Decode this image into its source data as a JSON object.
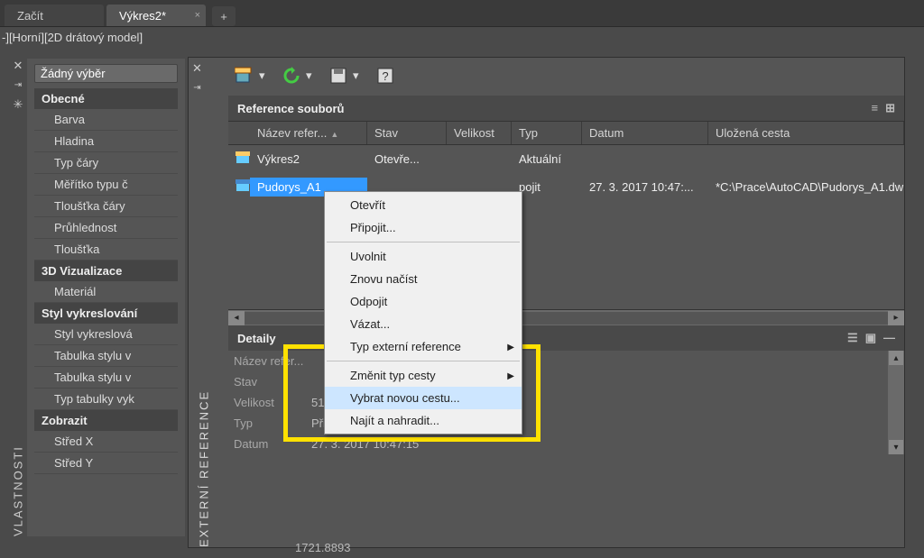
{
  "tabs": {
    "items": [
      "Začít",
      "Výkres2*"
    ],
    "active_index": 1
  },
  "viewport_label": "-][Horní][2D drátový model]",
  "properties": {
    "palette_title": "VLASTNOSTI",
    "selection": "Žádný výběr",
    "sections": {
      "obecne": {
        "title": "Obecné",
        "rows": [
          "Barva",
          "Hladina",
          "Typ čáry",
          "Měřítko typu č",
          "Tloušťka čáry",
          "Průhlednost",
          "Tloušťka"
        ]
      },
      "viz3d": {
        "title": "3D Vizualizace",
        "rows": [
          "Materiál"
        ]
      },
      "styl": {
        "title": "Styl vykreslování",
        "rows": [
          "Styl vykreslová",
          "Tabulka stylu v",
          "Tabulka stylu v",
          "Typ tabulky vyk"
        ]
      },
      "zobrazit": {
        "title": "Zobrazit",
        "rows": [
          "Střed X",
          "Střed Y"
        ]
      }
    },
    "stred_y_value": "1721.8893"
  },
  "xref": {
    "palette_title": "EXTERNÍ REFERENCE",
    "panel_title": "Reference souborů",
    "columns": {
      "name": "Název refer...",
      "stav": "Stav",
      "velikost": "Velikost",
      "typ": "Typ",
      "datum": "Datum",
      "cesta": "Uložená cesta"
    },
    "rows": [
      {
        "name": "Výkres2",
        "stav": "Otevře...",
        "velikost": "",
        "typ": "Aktuální",
        "datum": "",
        "cesta": ""
      },
      {
        "name": "Pudorys_A1",
        "stav": "",
        "velikost": "",
        "typ": "pojit",
        "datum": "27. 3. 2017 10:47:...",
        "cesta": "*C:\\Prace\\AutoCAD\\Pudorys_A1.dw"
      }
    ],
    "details": {
      "title": "Detaily",
      "rows": {
        "name": {
          "k": "Název refer...",
          "v": ""
        },
        "stav": {
          "k": "Stav",
          "v": ""
        },
        "vel": {
          "k": "Velikost",
          "v": "51,4 kB"
        },
        "typ": {
          "k": "Typ",
          "v": "Připojit"
        },
        "datum": {
          "k": "Datum",
          "v": "27. 3. 2017 10:47:15"
        }
      }
    }
  },
  "context_menu": {
    "items": [
      {
        "label": "Otevřít"
      },
      {
        "label": "Připojit..."
      },
      {
        "sep": true
      },
      {
        "label": "Uvolnit"
      },
      {
        "label": "Znovu načíst"
      },
      {
        "label": "Odpojit"
      },
      {
        "label": "Vázat..."
      },
      {
        "label": "Typ externí reference",
        "submenu": true
      },
      {
        "sep": true
      },
      {
        "label": "Změnit typ cesty",
        "submenu": true
      },
      {
        "label": "Vybrat novou cestu...",
        "hover": true
      },
      {
        "label": "Najít a nahradit..."
      }
    ]
  }
}
